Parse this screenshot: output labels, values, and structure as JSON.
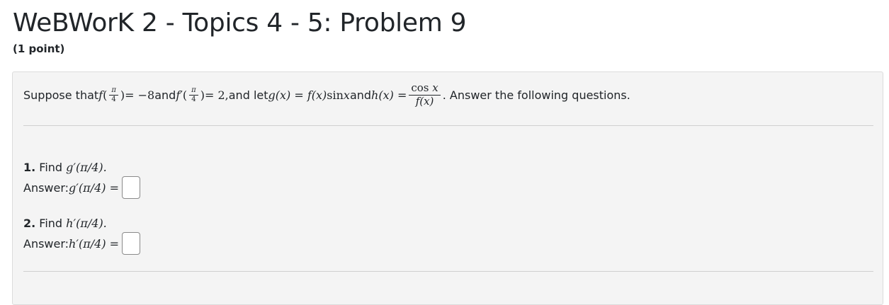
{
  "page": {
    "title": "WeBWorK 2 - Topics 4 - 5: Problem 9",
    "points": "(1 point)"
  },
  "problem": {
    "t_suppose": "Suppose that ",
    "t_f": "f",
    "t_open": "(",
    "t_pi": "π",
    "t_four": "4",
    "t_close": ")",
    "t_eq_neg8": " = −8",
    "t_and1": " and ",
    "t_fprime": "f′",
    "t_eq_2": " = 2,",
    "t_and_let": " and let ",
    "t_g_def": "g(x) = f(x) ",
    "t_sin": "sin ",
    "t_x": "x",
    "t_and2": " and ",
    "t_h_def": "h(x) = ",
    "t_cos": "cos ",
    "t_fx": "f(x)",
    "t_tail": ". Answer the following questions."
  },
  "questions": [
    {
      "number": "1.",
      "prompt_text": " Find ",
      "prompt_math": "g′(π/4).",
      "answer_label": "Answer: ",
      "answer_math": "g′(π/4) =",
      "value": ""
    },
    {
      "number": "2.",
      "prompt_text": " Find ",
      "prompt_math": "h′(π/4).",
      "answer_label": "Answer: ",
      "answer_math": "h′(π/4) =",
      "value": ""
    }
  ]
}
